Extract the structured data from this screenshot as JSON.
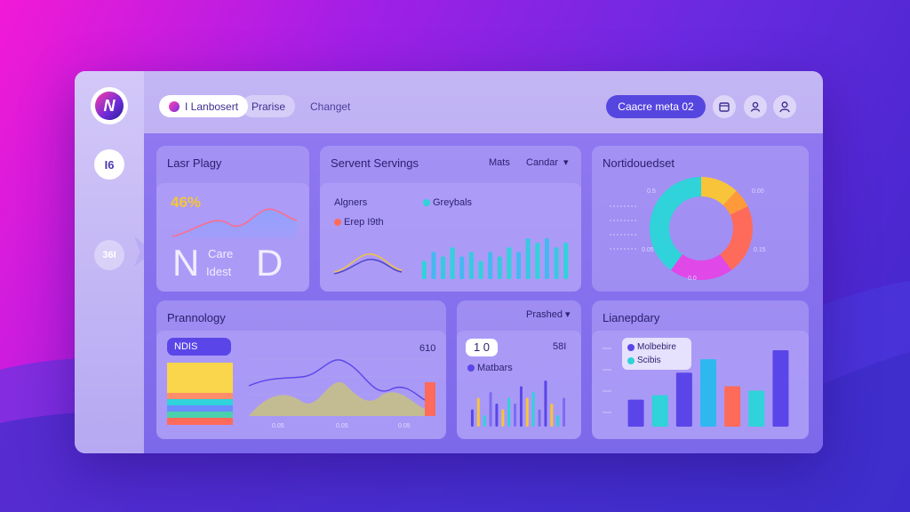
{
  "topbar": {
    "tabs": [
      {
        "label": "I Lanbosert"
      },
      {
        "label": "Prarise"
      },
      {
        "label": "Changet"
      }
    ],
    "cta_label": "Caacre meta 02"
  },
  "sidebar": {
    "logo_text": "N",
    "item1_label": "I6",
    "item2_label": "36I"
  },
  "cards": {
    "last_play": {
      "title": "Lasr Plagy",
      "stat": "46%",
      "big_left": "N",
      "big_right": "D",
      "line1": "Care",
      "line2": "Idest"
    },
    "servers": {
      "title": "Servent Servings",
      "filter1": "Mats",
      "filter2": "Candar",
      "legend": [
        {
          "label": "Algners"
        },
        {
          "label": "Greybals"
        },
        {
          "label": "Erep I9th"
        }
      ]
    },
    "notifications": {
      "title": "Nortidouedset",
      "labels": [
        "0.5",
        "0.00",
        "0.05",
        "0.15",
        "0.0"
      ]
    },
    "pranology": {
      "title": "Prannology",
      "badge": "NDIS",
      "value": "610",
      "ticks": [
        "0.05",
        "0.05",
        "0.05"
      ]
    },
    "middle": {
      "dropdown": "Prashed",
      "box_value": "1 0",
      "value": "58I",
      "legend": "Matbars"
    },
    "dependency": {
      "title": "Lianepdary",
      "legend": [
        {
          "label": "Molbebire"
        },
        {
          "label": "Scibis"
        }
      ]
    }
  },
  "colors": {
    "accent": "#5646e0",
    "yellow": "#f7c43a",
    "teal": "#2fd3d9",
    "coral": "#ff6b5a",
    "pink": "#d24af0",
    "blue": "#5b4fe0"
  },
  "chart_data": [
    {
      "type": "bar",
      "name": "servers-bars",
      "values": [
        4,
        6,
        5,
        7,
        5,
        6,
        4,
        6,
        5,
        7,
        6,
        9,
        8,
        9,
        7,
        8
      ]
    },
    {
      "type": "pie",
      "name": "notifications-donut",
      "slices": [
        {
          "color": "#f7c43a",
          "value": 12
        },
        {
          "color": "#ff9a3a",
          "value": 6
        },
        {
          "color": "#ff6b5a",
          "value": 22
        },
        {
          "color": "#e048e8",
          "value": 20
        },
        {
          "color": "#2fd3d9",
          "value": 40
        }
      ]
    },
    {
      "type": "bar",
      "name": "middle-bars",
      "values": [
        3,
        5,
        2,
        6,
        4,
        3,
        5,
        4,
        7,
        5,
        6,
        3,
        8,
        4,
        2,
        5
      ]
    },
    {
      "type": "bar",
      "name": "dependency-bars",
      "values": [
        30,
        35,
        60,
        75,
        45,
        40,
        85
      ]
    }
  ]
}
